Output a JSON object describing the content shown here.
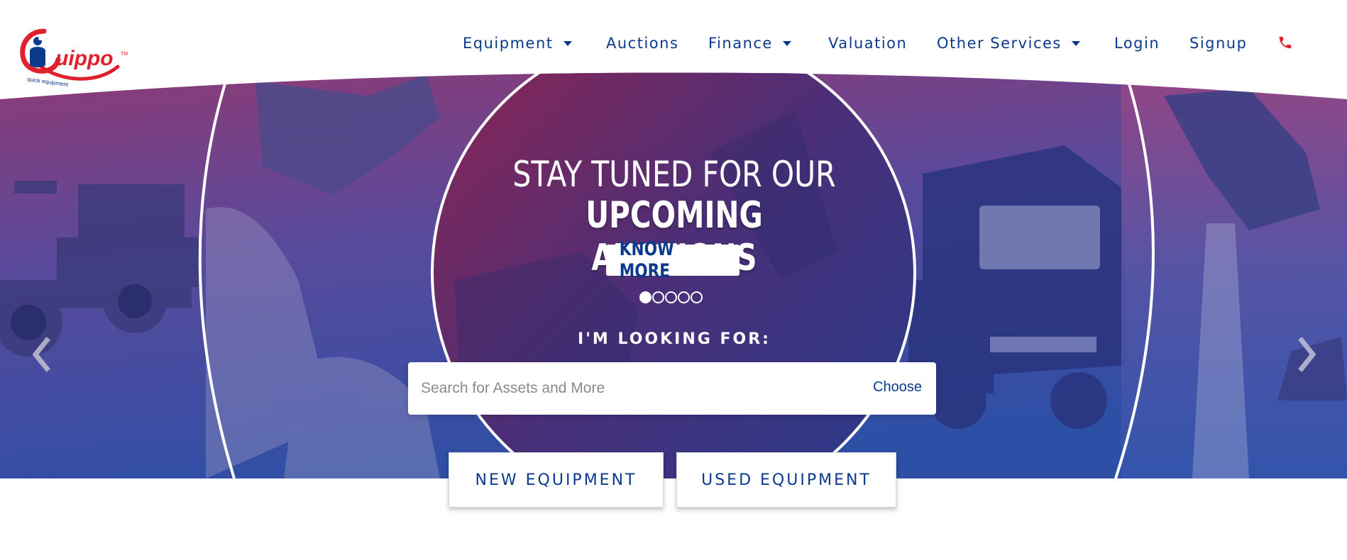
{
  "brand": {
    "logo_text": "uippo",
    "logo_tagline": "quick equipment",
    "logo_tm": "TM",
    "accent_red": "#e0202c",
    "accent_blue": "#0b3a8c"
  },
  "nav": {
    "items": [
      {
        "label": "Equipment",
        "dropdown": true
      },
      {
        "label": "Auctions",
        "dropdown": false
      },
      {
        "label": "Finance",
        "dropdown": true
      },
      {
        "label": "Valuation",
        "dropdown": false
      },
      {
        "label": "Other Services",
        "dropdown": true
      },
      {
        "label": "Login",
        "dropdown": false
      },
      {
        "label": "Signup",
        "dropdown": false
      }
    ],
    "phone_icon": "phone-icon"
  },
  "hero": {
    "headline_line1": "STAY TUNED FOR OUR",
    "headline_line2": "UPCOMING AUCTIONS",
    "cta_label": "KNOW MORE",
    "slides_total": 5,
    "active_slide": 1,
    "prev_icon": "chevron-left-icon",
    "next_icon": "chevron-right-icon"
  },
  "search": {
    "heading": "I'M LOOKING FOR:",
    "placeholder": "Search for Assets and More",
    "value": "",
    "choose_label": "Choose"
  },
  "buttons": {
    "new_equipment": "NEW EQUIPMENT",
    "used_equipment": "USED EQUIPMENT"
  }
}
